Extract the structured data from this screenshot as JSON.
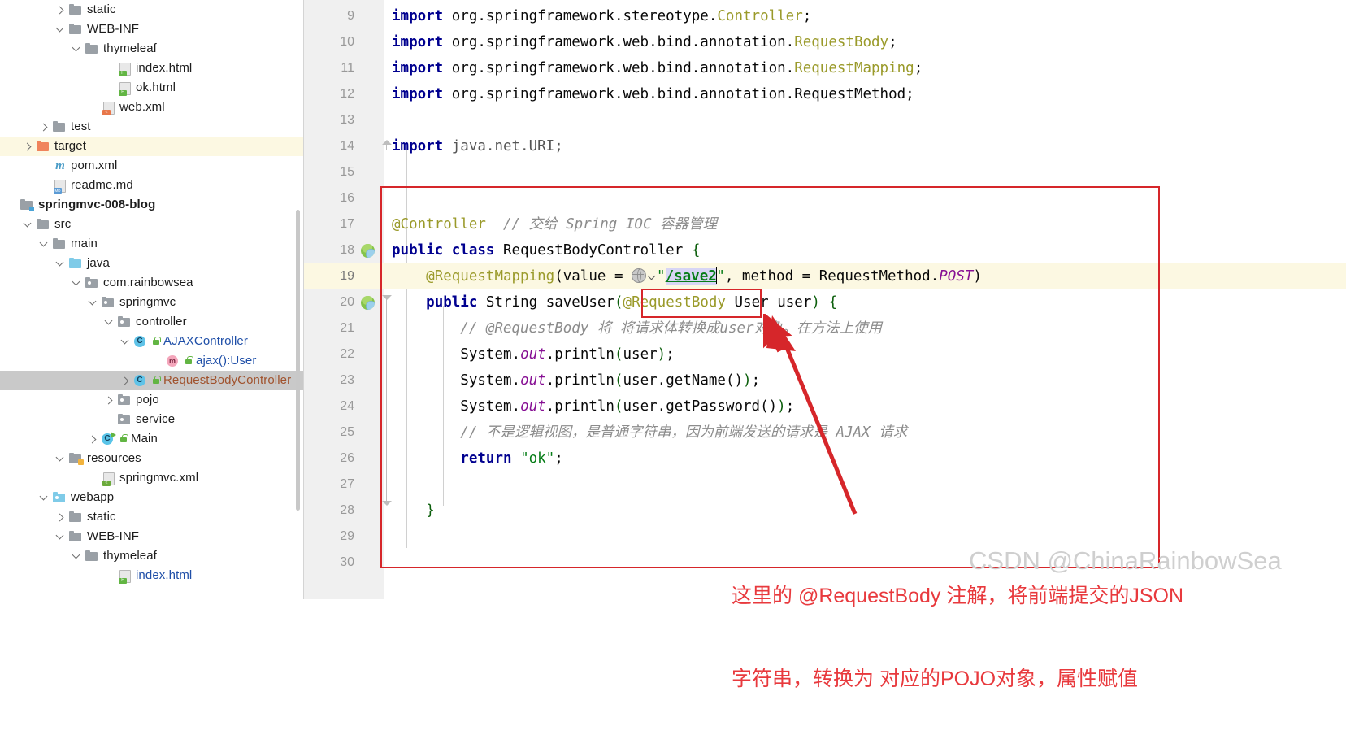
{
  "project_tree": {
    "items": [
      {
        "indent": 3,
        "arrow": "right",
        "icon": "folder",
        "label": "static",
        "state": "partial"
      },
      {
        "indent": 3,
        "arrow": "down",
        "icon": "folder",
        "label": "WEB-INF"
      },
      {
        "indent": 4,
        "arrow": "down",
        "icon": "folder",
        "label": "thymeleaf"
      },
      {
        "indent": 6,
        "arrow": "none",
        "icon": "file-html",
        "label": "index.html"
      },
      {
        "indent": 6,
        "arrow": "none",
        "icon": "file-html",
        "label": "ok.html"
      },
      {
        "indent": 5,
        "arrow": "none",
        "icon": "file-xml",
        "label": "web.xml"
      },
      {
        "indent": 2,
        "arrow": "right",
        "icon": "folder",
        "label": "test"
      },
      {
        "indent": 1,
        "arrow": "right",
        "icon": "folder-orange",
        "label": "target",
        "row": "highlighted"
      },
      {
        "indent": 2,
        "arrow": "none",
        "icon": "maven",
        "label": "pom.xml"
      },
      {
        "indent": 2,
        "arrow": "none",
        "icon": "file-md",
        "label": "readme.md"
      },
      {
        "indent": 0,
        "arrow": "none",
        "icon": "module",
        "label": "springmvc-008-blog",
        "bold": true
      },
      {
        "indent": 1,
        "arrow": "down",
        "icon": "folder",
        "label": "src"
      },
      {
        "indent": 2,
        "arrow": "down",
        "icon": "folder",
        "label": "main"
      },
      {
        "indent": 3,
        "arrow": "down",
        "icon": "folder-blue",
        "label": "java"
      },
      {
        "indent": 4,
        "arrow": "down",
        "icon": "package",
        "label": "com.rainbowsea"
      },
      {
        "indent": 5,
        "arrow": "down",
        "icon": "package",
        "label": "springmvc"
      },
      {
        "indent": 6,
        "arrow": "down",
        "icon": "package",
        "label": "controller"
      },
      {
        "indent": 7,
        "arrow": "down",
        "icon": "class",
        "label": "AJAXController",
        "color": "blue",
        "lock": true
      },
      {
        "indent": 9,
        "arrow": "none",
        "icon": "method",
        "label": "ajax():User",
        "color": "blue",
        "lock": true
      },
      {
        "indent": 7,
        "arrow": "right",
        "icon": "class",
        "label": "RequestBodyController",
        "color": "brown",
        "lock": true,
        "row": "selected"
      },
      {
        "indent": 6,
        "arrow": "right",
        "icon": "package",
        "label": "pojo"
      },
      {
        "indent": 6,
        "arrow": "none",
        "icon": "package",
        "label": "service"
      },
      {
        "indent": 5,
        "arrow": "right",
        "icon": "class-run",
        "label": "Main",
        "lock": true
      },
      {
        "indent": 3,
        "arrow": "down",
        "icon": "folder-res",
        "label": "resources"
      },
      {
        "indent": 5,
        "arrow": "none",
        "icon": "file-spring",
        "label": "springmvc.xml"
      },
      {
        "indent": 2,
        "arrow": "down",
        "icon": "package-web",
        "label": "webapp"
      },
      {
        "indent": 3,
        "arrow": "right",
        "icon": "folder",
        "label": "static"
      },
      {
        "indent": 3,
        "arrow": "down",
        "icon": "folder",
        "label": "WEB-INF"
      },
      {
        "indent": 4,
        "arrow": "down",
        "icon": "folder",
        "label": "thymeleaf"
      },
      {
        "indent": 6,
        "arrow": "none",
        "icon": "file-html",
        "label": "index.html",
        "color": "blue"
      }
    ]
  },
  "editor": {
    "line_numbers": [
      "9",
      "10",
      "11",
      "12",
      "13",
      "14",
      "15",
      "16",
      "17",
      "18",
      "19",
      "20",
      "21",
      "22",
      "23",
      "24",
      "25",
      "26",
      "27",
      "28",
      "29",
      "30"
    ],
    "gutter_icons": {
      "18": "spring-bean-icon",
      "20": "spring-bean-icon"
    },
    "highlighted_line": "19",
    "code_lines": {
      "9": "import org.springframework.stereotype.Controller;",
      "10": "import org.springframework.web.bind.annotation.RequestBody;",
      "11": "import org.springframework.web.bind.annotation.RequestMapping;",
      "12": "import org.springframework.web.bind.annotation.RequestMethod;",
      "13": "",
      "14": "import java.net.URI;",
      "15": "",
      "16": "",
      "17": "@Controller  // 交给 Spring IOC 容器管理",
      "18": "public class RequestBodyController {",
      "19": "    @RequestMapping(value = \"/save2\", method = RequestMethod.POST)",
      "20": "    public String saveUser(@RequestBody User user) {",
      "21": "        // @RequestBody 将 将请求体转换成user对象。在方法上使用",
      "22": "        System.out.println(user);",
      "23": "        System.out.println(user.getName());",
      "24": "        System.out.println(user.getPassword());",
      "25": "        // 不是逻辑视图，是普通字符串，因为前端发送的请求是 AJAX 请求",
      "26": "        return \"ok\";",
      "27": "",
      "28": "    }",
      "29": "",
      "30": ""
    },
    "tokens": {
      "import": "import",
      "semicolon": ";",
      "pkg9": "org.springframework.stereotype.",
      "cls9": "Controller",
      "pkg10": "org.springframework.web.bind.annotation.",
      "cls10": "RequestBody",
      "pkg11": "org.springframework.web.bind.annotation.",
      "cls11": "RequestMapping",
      "pkg12": "org.springframework.web.bind.annotation.RequestMethod",
      "import14": "import",
      "pkg14": "java.net.URI",
      "anno_controller": "@Controller",
      "comment17": "// 交给 Spring IOC 容器管理",
      "kw_public": "public",
      "kw_class": "class",
      "classname": "RequestBodyController",
      "brace_open": "{",
      "anno_mapping": "@RequestMapping",
      "value_label": "(value = ",
      "quote": "\"",
      "url_value": "/save2",
      "method_part": ", method = RequestMethod.",
      "post": "POST",
      "paren_close": ")",
      "kw_public20": "public",
      "type_string": "String",
      "method_name": "saveUser",
      "anno_body": "@RequestBody",
      "param_type": "User",
      "param_name": "user",
      "comment21": "// @RequestBody 将 将请求体转换成user对象。在方法上使用",
      "system": "System.",
      "out": "out",
      "println": ".println",
      "arg_user": "user",
      "arg_getname": "user.getName()",
      "arg_getpassword": "user.getPassword()",
      "comment25": "// 不是逻辑视图，是普通字符串，因为前端发送的请求是 AJAX 请求",
      "kw_return": "return",
      "str_ok": "\"ok\"",
      "brace_close": "}"
    }
  },
  "annotation": {
    "line1": "这里的 @RequestBody 注解，将前端提交的JSON",
    "line2": "字符串，转换为 对应的POJO对象，属性赋值",
    "color": "#e8393d"
  },
  "watermark": {
    "text": "CSDN @ChinaRainbowSea",
    "color": "#cfcfcf"
  },
  "colors": {
    "selection": "#c9c9c9",
    "line_highlight": "#fcf8e2",
    "annotation_red": "#d6262a",
    "keyword": "#00008f",
    "string": "#067d17",
    "annotation_token": "#9a9a2a",
    "comment": "#8c8c8c",
    "static_field": "#871094"
  }
}
